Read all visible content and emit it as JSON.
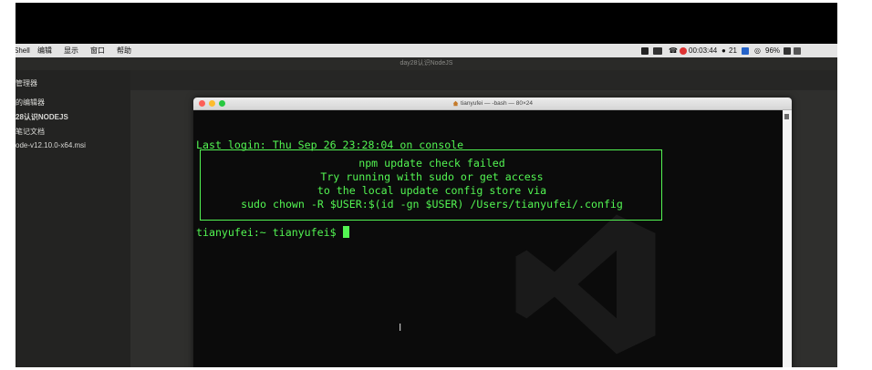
{
  "menubar": {
    "items": [
      "Shell",
      "编辑",
      "显示",
      "窗口",
      "帮助"
    ],
    "clock": "00:03:44",
    "notification_count": "21",
    "battery_text": "96%",
    "colors": {
      "bar_bg": "#e4e4e4"
    }
  },
  "vscode": {
    "window_title": "day28认识NodeJS",
    "sidebar": {
      "rows": [
        "管理器",
        "的编辑器",
        "28认识NODEJS",
        "笔记文档",
        "ode-v12.10.0-x64.msi"
      ]
    }
  },
  "terminal": {
    "title": "tianyufei — -bash — 80×24",
    "last_login": "Last login: Thu Sep 26 23:28:04 on console",
    "update_box": {
      "lines": [
        "npm update check failed",
        "Try running with sudo or get access",
        "to the local update config store via",
        "sudo chown -R $USER:$(id -gn $USER) /Users/tianyufei/.config"
      ]
    },
    "prompt": "tianyufei:~ tianyufei$ ",
    "colors": {
      "fg": "#53f552",
      "bg": "#0b0b0b"
    }
  }
}
